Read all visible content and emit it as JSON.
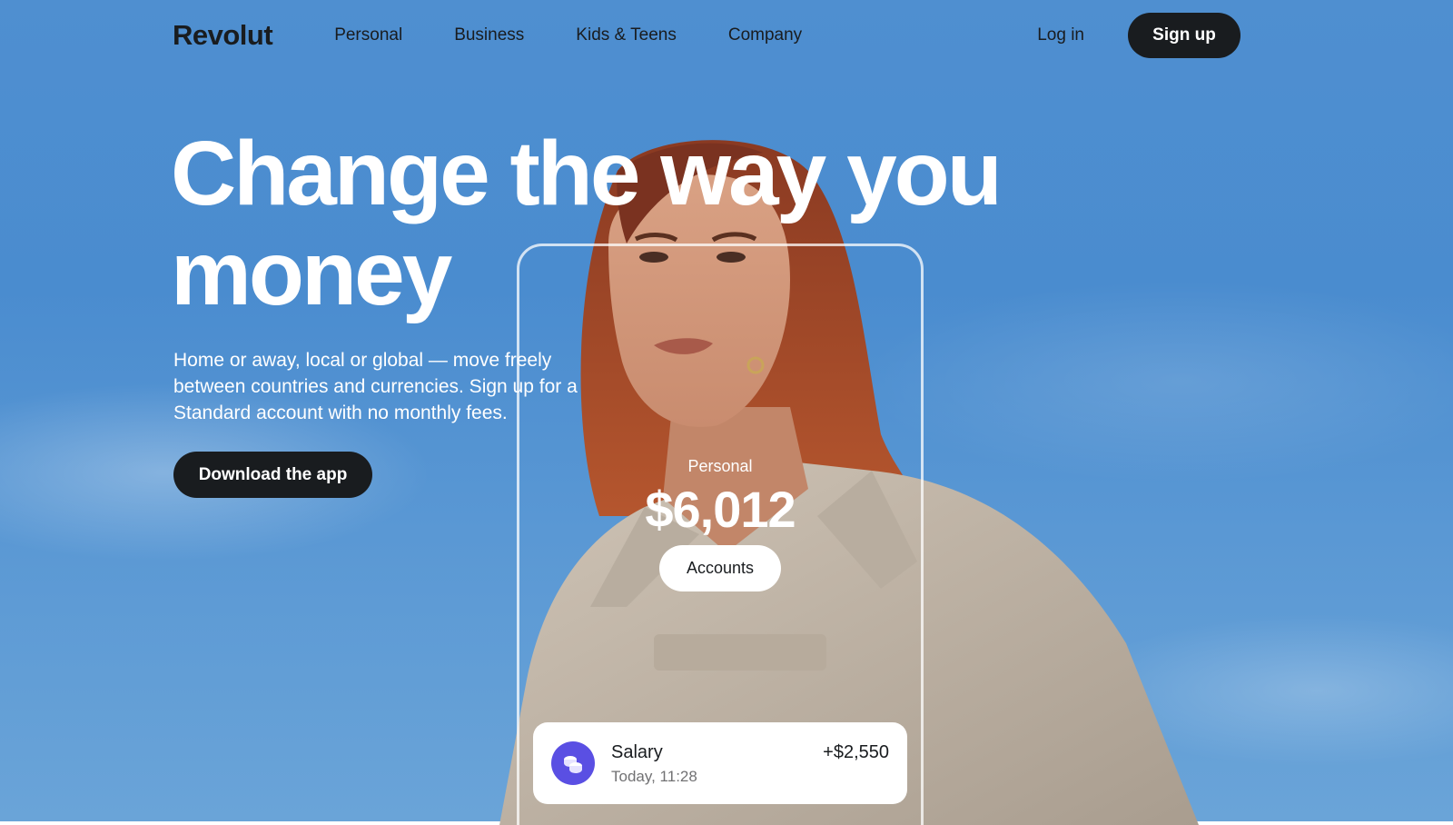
{
  "nav": {
    "logo": "Revolut",
    "links": [
      "Personal",
      "Business",
      "Kids & Teens",
      "Company"
    ],
    "login": "Log in",
    "signup": "Sign up"
  },
  "hero": {
    "headline": "Change the way you money",
    "subtitle": "Home or away, local or global — move freely between countries and currencies. Sign up for a Standard account with no monthly fees.",
    "cta": "Download the app"
  },
  "phone": {
    "label": "Personal",
    "balance": "$6,012",
    "accounts_button": "Accounts",
    "transaction": {
      "title": "Salary",
      "time": "Today, 11:28",
      "amount": "+$2,550",
      "icon": "coins-icon"
    }
  },
  "colors": {
    "sky": "#4f8fd0",
    "dark": "#191c1f",
    "accent": "#5a4fe3"
  }
}
